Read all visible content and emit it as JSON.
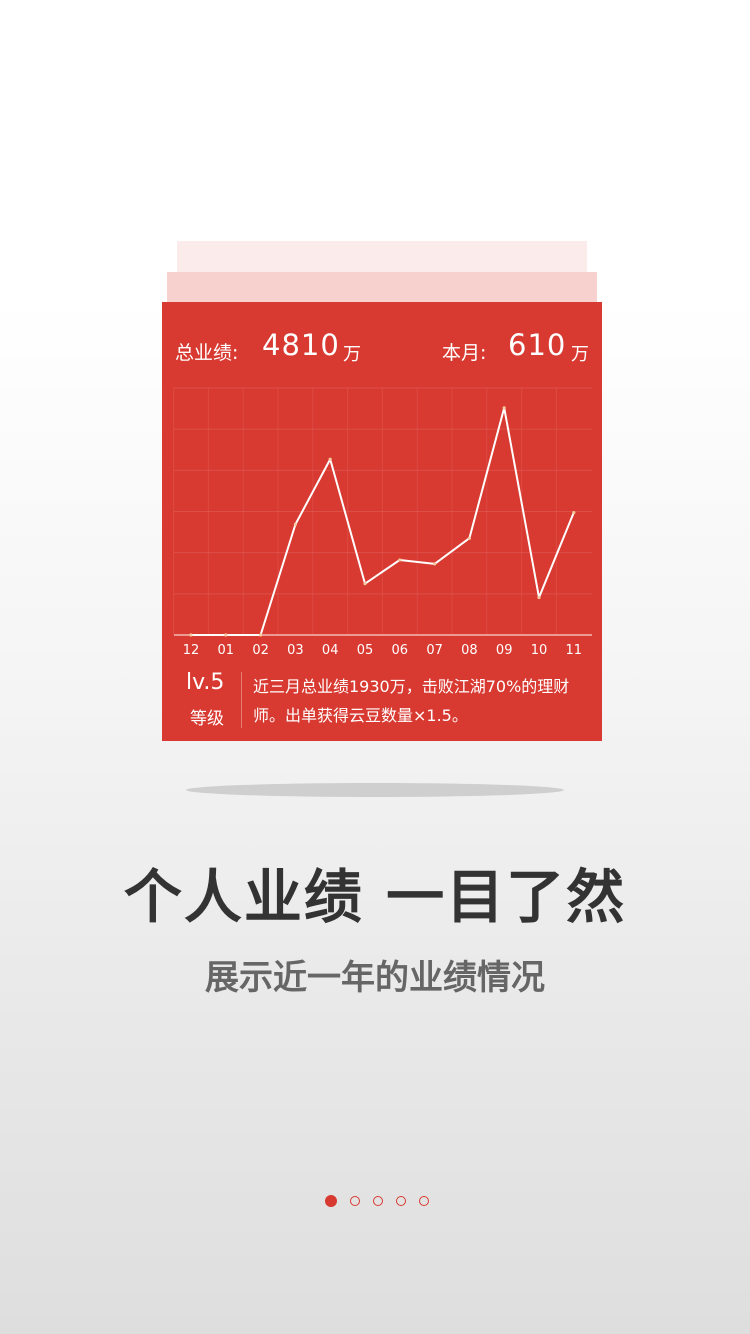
{
  "card": {
    "total_label": "总业绩:",
    "total_value": "4810",
    "total_unit": "万",
    "month_label": "本月:",
    "month_value": "610",
    "month_unit": "万",
    "level_value": "lv.5",
    "level_label": "等级",
    "description": "近三月总业绩1930万，击败江湖70%的理财师。出单获得云豆数量×1.5。"
  },
  "chart_data": {
    "type": "line",
    "categories": [
      "12",
      "01",
      "02",
      "03",
      "04",
      "05",
      "06",
      "07",
      "08",
      "09",
      "10",
      "11"
    ],
    "series": [
      {
        "values": [
          0,
          0,
          0,
          280,
          445,
          130,
          190,
          180,
          245,
          575,
          95,
          310
        ]
      }
    ],
    "ylim": [
      0,
      600
    ],
    "grid": true,
    "colors": {
      "line": "#ffffff",
      "grid": "#e06159",
      "background": "#d83a31"
    }
  },
  "headline": "个人业绩  一目了然",
  "subhead": "展示近一年的业绩情况",
  "pager": {
    "count": 5,
    "active_index": 0,
    "accent": "#d83a31"
  }
}
